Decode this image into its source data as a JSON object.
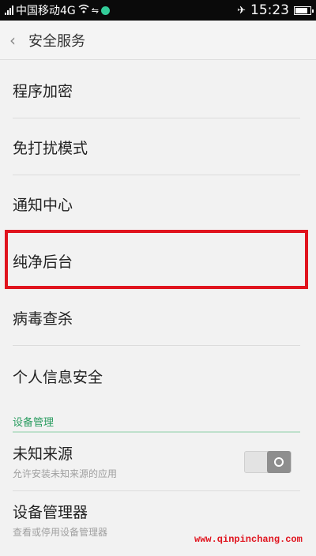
{
  "status_bar": {
    "carrier": "中国移动4G",
    "time": "15:23"
  },
  "header": {
    "title": "安全服务"
  },
  "menu": {
    "items": [
      {
        "label": "程序加密"
      },
      {
        "label": "免打扰模式"
      },
      {
        "label": "通知中心"
      },
      {
        "label": "纯净后台"
      },
      {
        "label": "病毒查杀"
      },
      {
        "label": "个人信息安全"
      }
    ]
  },
  "device_management": {
    "section_title": "设备管理",
    "unknown_sources": {
      "title": "未知来源",
      "subtitle": "允许安装未知来源的应用",
      "toggle_on": false
    },
    "device_admin": {
      "title": "设备管理器",
      "subtitle": "查看或停用设备管理器"
    }
  },
  "watermark": "www.qinpinchang.com",
  "colors": {
    "highlight_border": "#e0141e",
    "section_accent": "#2a9c60"
  }
}
